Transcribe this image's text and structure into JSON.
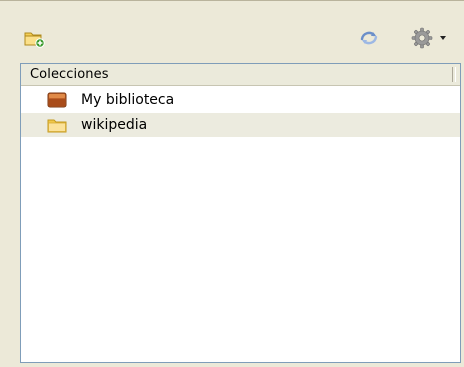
{
  "toolbar": {
    "new_collection_icon": "new-collection-folder-icon",
    "sync_icon": "sync-icon",
    "actions_icon": "gear-icon",
    "actions_dropdown_icon": "chevron-down-icon"
  },
  "tree": {
    "header_label": "Colecciones",
    "items": [
      {
        "label": "My biblioteca",
        "icon": "library-icon",
        "selected": false
      },
      {
        "label": "wikipedia",
        "icon": "folder-icon",
        "selected": true
      }
    ]
  },
  "colors": {
    "panel_bg": "#ece9d8",
    "tree_border": "#7f9db9",
    "selected_row": "#ecebdf",
    "folder_yellow": "#f6d35e",
    "library_brown": "#b8541c"
  }
}
